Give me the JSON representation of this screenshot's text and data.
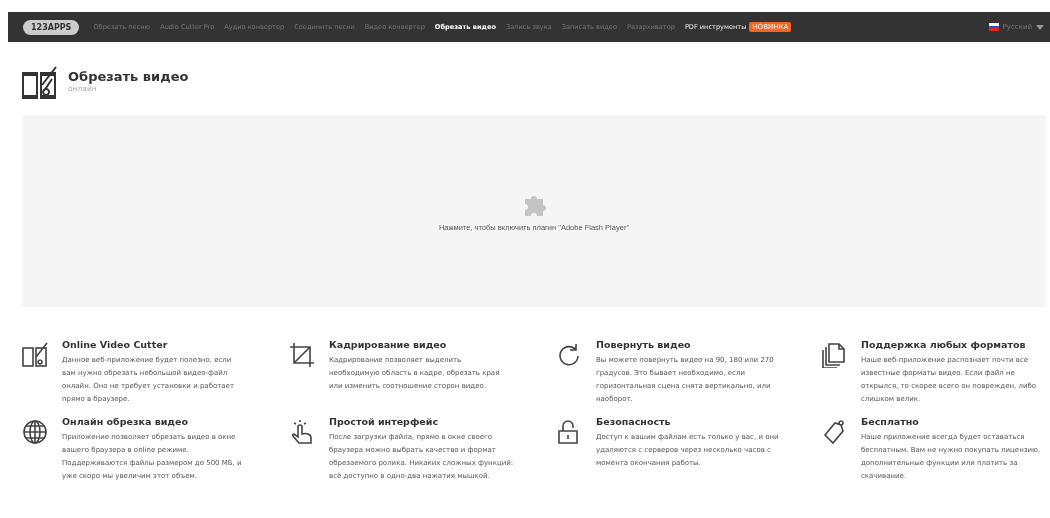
{
  "nav": {
    "logo": "123APPS",
    "items": [
      {
        "label": "Обрезать песню",
        "selected": false
      },
      {
        "label": "Audio Cutter Pro",
        "selected": false
      },
      {
        "label": "Аудио конвертер",
        "selected": false
      },
      {
        "label": "Соединить песни",
        "selected": false
      },
      {
        "label": "Видео конвертер",
        "selected": false
      },
      {
        "label": "Обрезать видео",
        "selected": true
      },
      {
        "label": "Запись звука",
        "selected": false
      },
      {
        "label": "Записать видео",
        "selected": false
      },
      {
        "label": "Разархиватор",
        "selected": false
      },
      {
        "label": "PDF инструменты",
        "selected": false,
        "kind": "promo",
        "badge": "НОВИНКА"
      }
    ],
    "language": "Русский"
  },
  "header": {
    "title": "Обрезать видео",
    "subtitle": "онлайн"
  },
  "plugin": {
    "message": "Нажмите, чтобы включить плагин \"Adobe Flash Player\""
  },
  "features": [
    {
      "title": "Online Video Cutter",
      "text": "Данное веб-приложение будет полезно, если вам нужно обрезать небольшой видео-файл онлайн. Оно не требует установки и работает прямо в браузере."
    },
    {
      "title": "Кадрирование видео",
      "text": "Кадрирование позволяет выделить необходимую область в кадре, обрезать края или изменить соотношение сторон видео."
    },
    {
      "title": "Повернуть видео",
      "text": "Вы можете повернуть видео на 90, 180 или 270 градусов. Это бывает необходимо, если горизонтальная сцена снята вертикально, или наоборот."
    },
    {
      "title": "Поддержка любых форматов",
      "text": "Наше веб-приложение распознает почти все известные форматы видео. Если файл не открылся, то скорее всего он поврежден, либо слишком велик."
    },
    {
      "title": "Онлайн обрезка видео",
      "text": "Приложение позволяет обрезать видео в окне вашего браузера в online режиме. Поддерживаются файлы размером до 500 МБ, и уже скоро мы увеличим этот объем."
    },
    {
      "title": "Простой интерфейс",
      "text": "После загрузки файла, прямо в окне своего браузера можно выбрать качество и формат обрезаемого ролика. Никаких сложных функций: всё доступно в одно-два нажатия мышкой."
    },
    {
      "title": "Безопасность",
      "text": "Доступ к вашим файлам есть только у вас, и они удаляются с серверов через несколько часов с момента окончания работы."
    },
    {
      "title": "Бесплатно",
      "text": "Наше приложение всегда будет оставаться бесплатным. Вам не нужно покупать лицензию, дополнительные функции или платить за скачивание."
    }
  ]
}
